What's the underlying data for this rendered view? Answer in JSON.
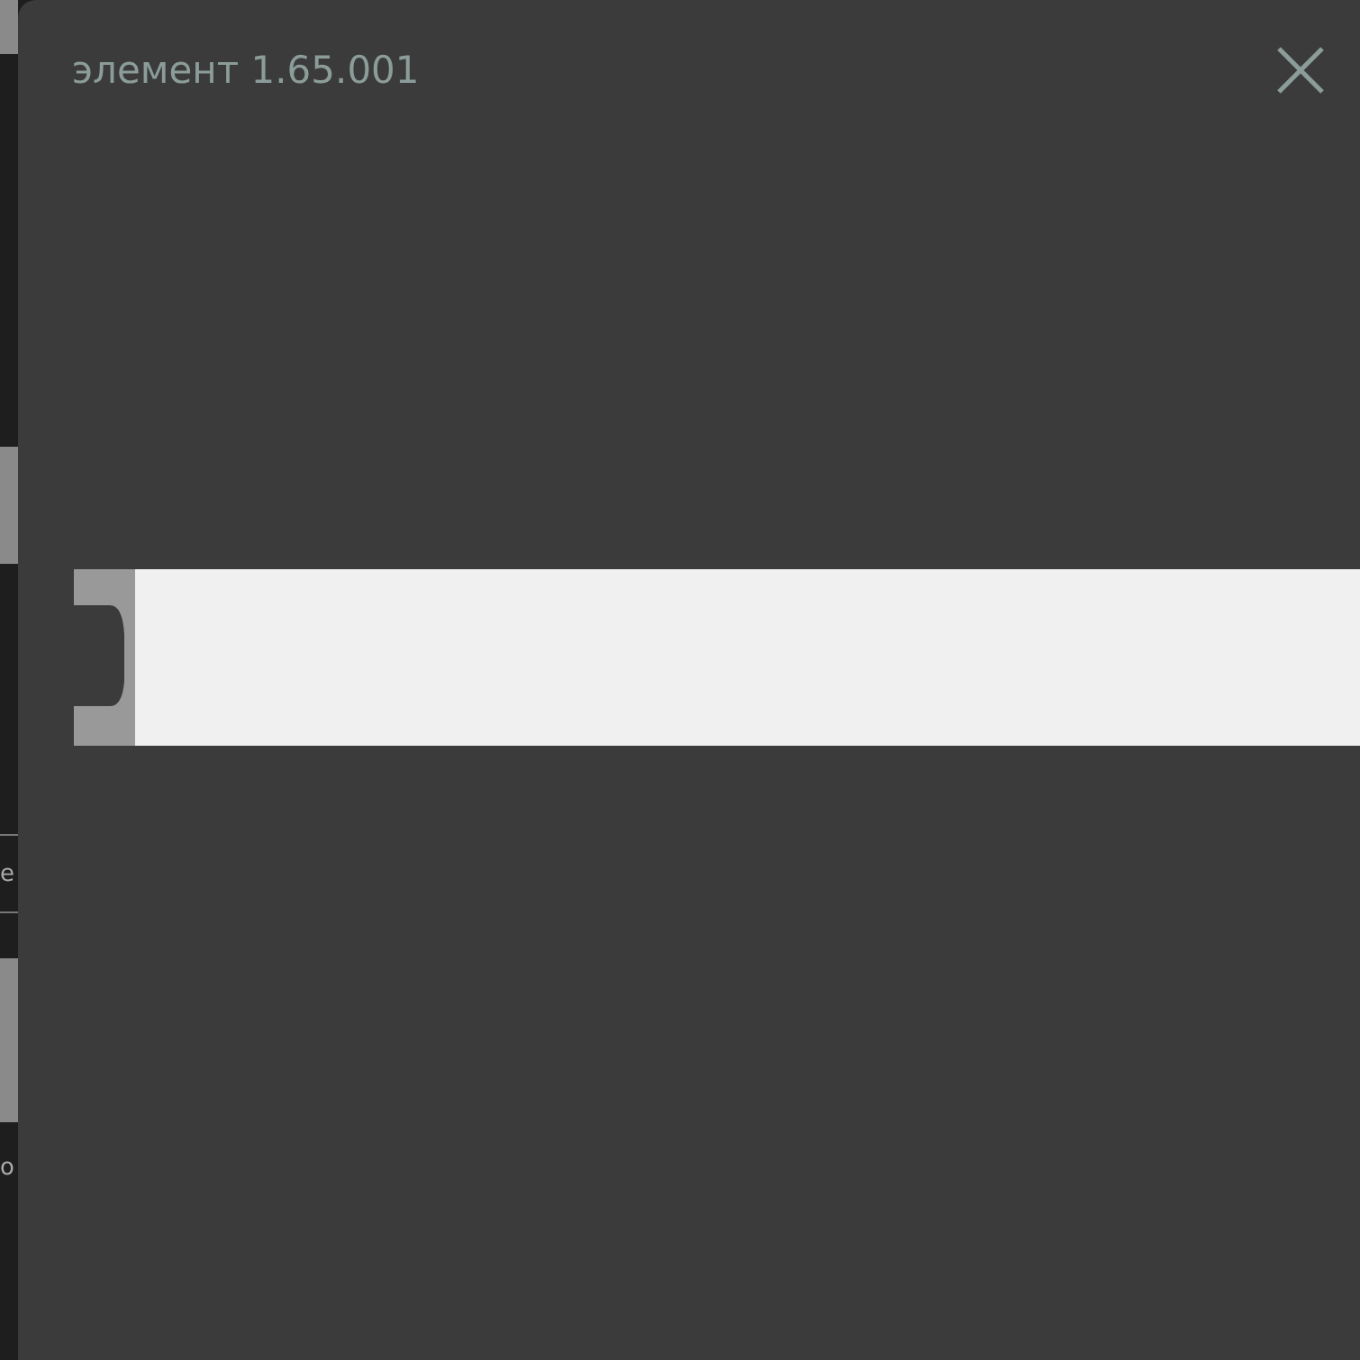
{
  "background_page": {
    "text_fragments": [
      "e",
      "o"
    ]
  },
  "dialog": {
    "title": "элемент 1.65.001"
  }
}
